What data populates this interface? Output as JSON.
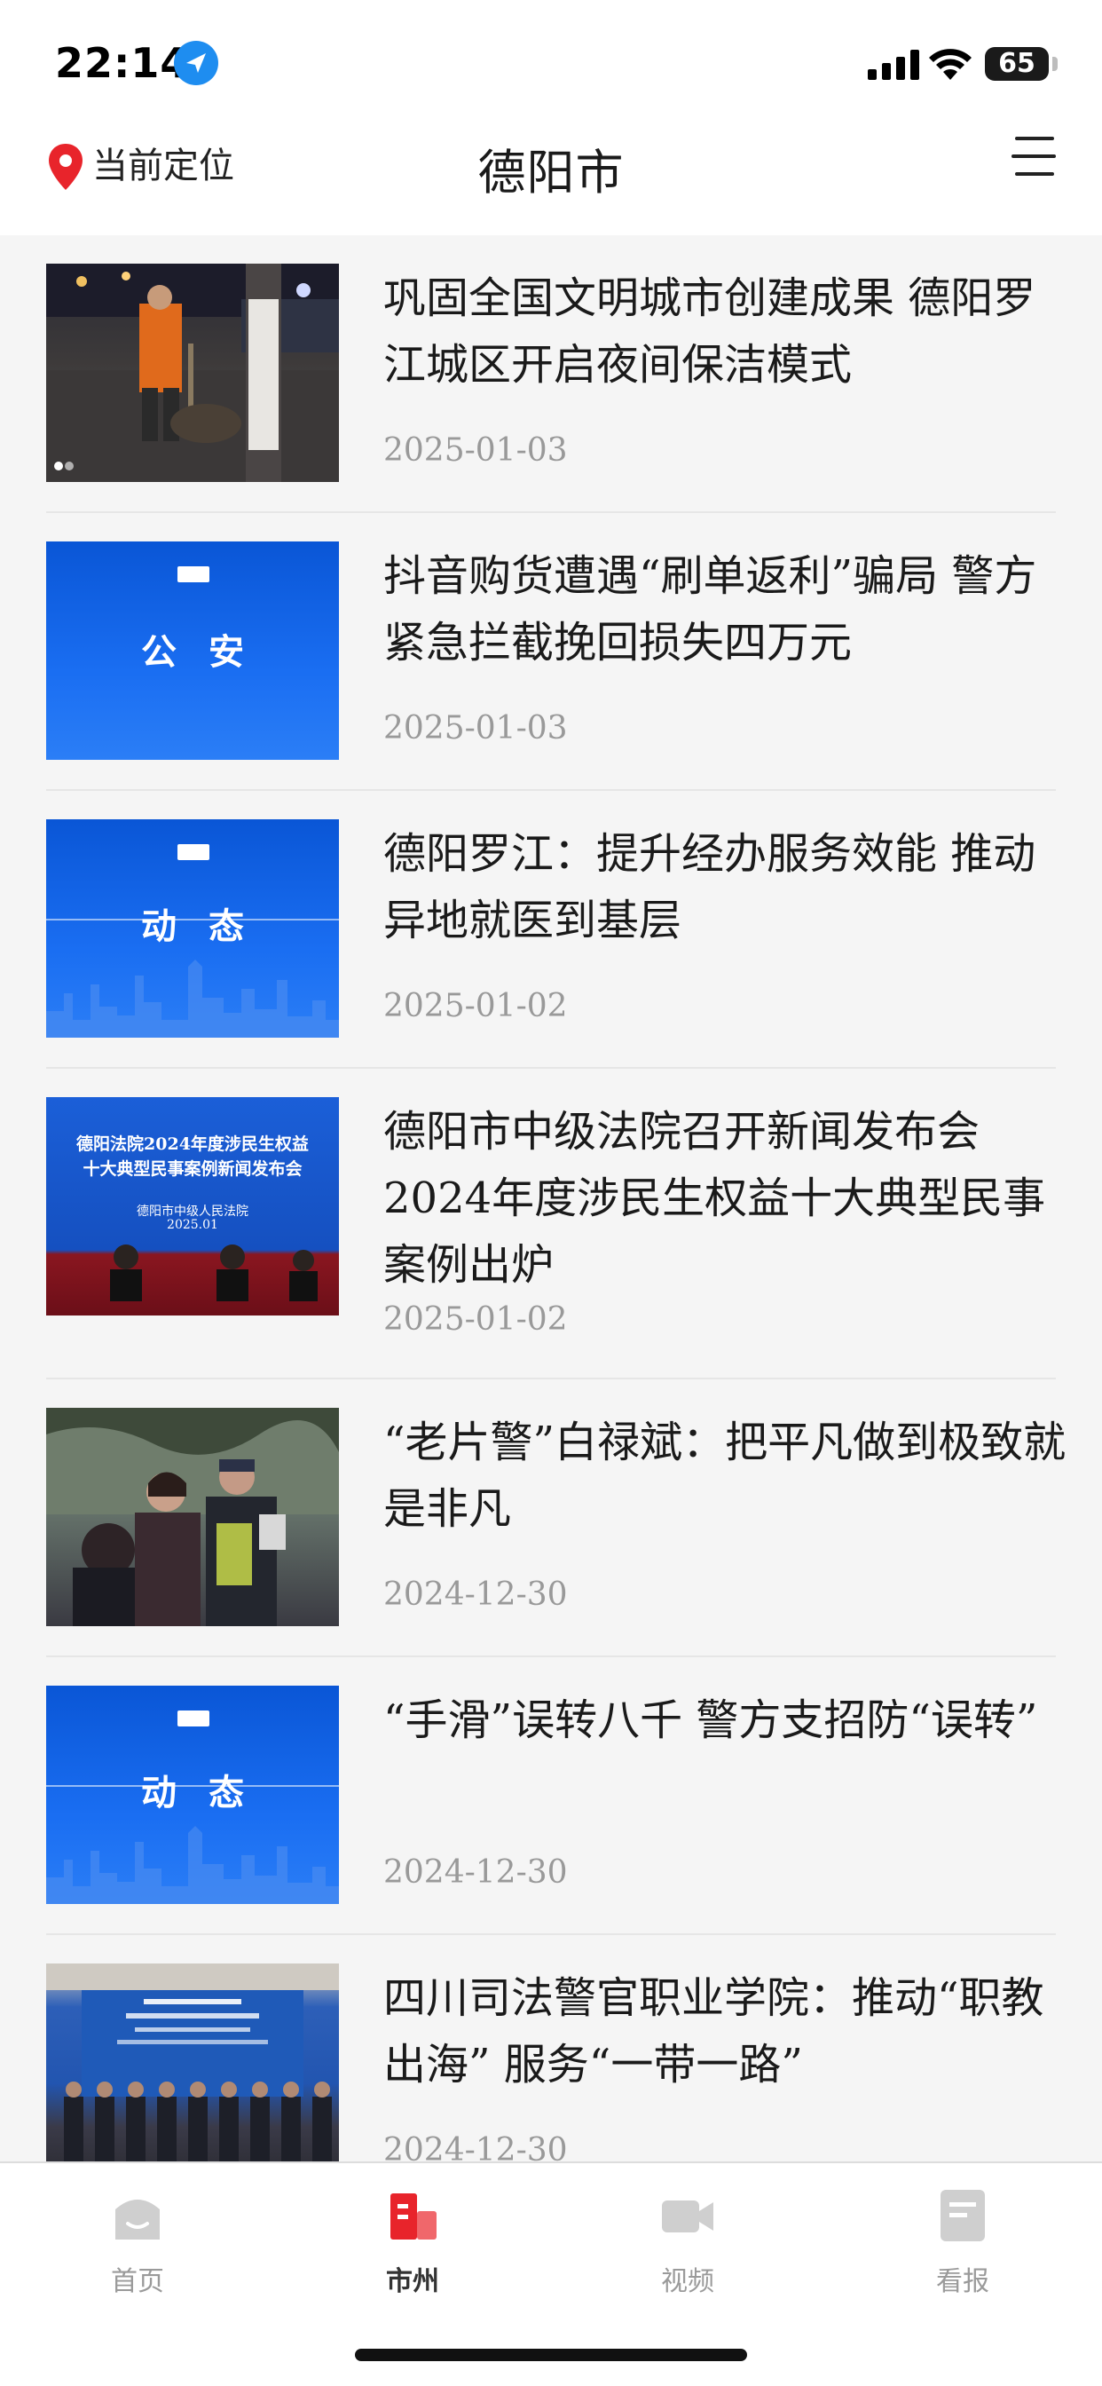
{
  "status_bar": {
    "time": "22:14",
    "battery": "65"
  },
  "header": {
    "location_label": "当前定位",
    "title": "德阳市"
  },
  "news": [
    {
      "title": "巩固全国文明城市创建成果 德阳罗江城区开启夜间保洁模式",
      "date": "2025-01-03",
      "thumb": "photo-street-cleaner"
    },
    {
      "title": "抖音购货遭遇“刷单返利”骗局 警方紧急拦截挽回损失四万元",
      "date": "2025-01-03",
      "thumb": "police-graphic",
      "thumb_text": "公安"
    },
    {
      "title": "德阳罗江：提升经办服务效能 推动异地就医到基层",
      "date": "2025-01-02",
      "thumb": "dynamics-graphic",
      "thumb_text": "动态"
    },
    {
      "title": "德阳市中级法院召开新闻发布会 2024年度涉民生权益十大典型民事案例出炉",
      "date": "2025-01-02",
      "thumb": "court-press-conference",
      "thumb_line1": "德阳法院2024年度涉民生权益",
      "thumb_line2": "十大典型民事案例新闻发布会",
      "thumb_line3": "德阳市中级人民法院",
      "thumb_line4": "2025.01"
    },
    {
      "title": "“老片警”白禄斌：把平凡做到极致就是非凡",
      "date": "2024-12-30",
      "thumb": "photo-police-officer"
    },
    {
      "title": "“手滑”误转八千 警方支招防“误转”",
      "date": "2024-12-30",
      "thumb": "dynamics-graphic",
      "thumb_text": "动态"
    },
    {
      "title": "四川司法警官职业学院：推动“职教出海” 服务“一带一路”",
      "date": "2024-12-30",
      "thumb": "photo-group-meeting"
    }
  ],
  "tabs": [
    {
      "label": "首页",
      "icon": "home-icon",
      "active": false
    },
    {
      "label": "市州",
      "icon": "city-icon",
      "active": true
    },
    {
      "label": "视频",
      "icon": "video-icon",
      "active": false
    },
    {
      "label": "看报",
      "icon": "newspaper-icon",
      "active": false
    }
  ],
  "colors": {
    "accent": "#e8242b",
    "link_blue": "#1e8df0",
    "thumb_blue": "#1a6ef2"
  }
}
